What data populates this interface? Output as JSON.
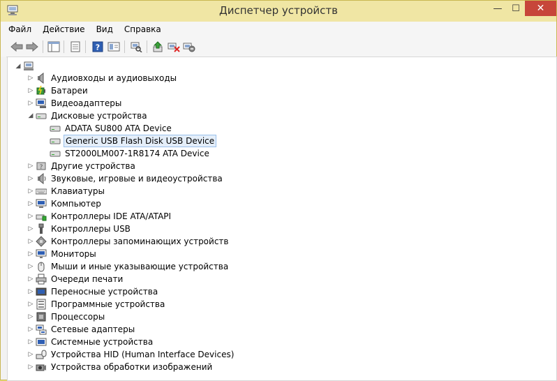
{
  "window": {
    "title": "Диспетчер устройств"
  },
  "menu": {
    "items": [
      "Файл",
      "Действие",
      "Вид",
      "Справка"
    ]
  },
  "toolbar": {
    "buttons": [
      "back-icon",
      "forward-icon",
      "show-hide-tree-icon",
      "properties-icon",
      "help-icon",
      "view-icon",
      "scan-hardware-icon",
      "update-driver-icon",
      "disable-device-icon",
      "uninstall-device-icon"
    ]
  },
  "tree": {
    "root": {
      "label": ""
    },
    "items": [
      {
        "label": "Аудиовходы и аудиовыходы",
        "icon": "speaker-icon"
      },
      {
        "label": "Батареи",
        "icon": "battery-icon"
      },
      {
        "label": "Видеоадаптеры",
        "icon": "display-adapter-icon"
      },
      {
        "label": "Дисковые устройства",
        "icon": "disk-drive-icon",
        "expanded": true,
        "children": [
          {
            "label": "ADATA SU800 ATA Device"
          },
          {
            "label": "Generic USB Flash Disk USB Device",
            "selected": true
          },
          {
            "label": "ST2000LM007-1R8174 ATA Device"
          }
        ]
      },
      {
        "label": "Другие устройства",
        "icon": "other-devices-icon"
      },
      {
        "label": "Звуковые, игровые и видеоустройства",
        "icon": "sound-icon"
      },
      {
        "label": "Клавиатуры",
        "icon": "keyboard-icon"
      },
      {
        "label": "Компьютер",
        "icon": "computer-icon"
      },
      {
        "label": "Контроллеры IDE ATA/ATAPI",
        "icon": "ide-controller-icon"
      },
      {
        "label": "Контроллеры USB",
        "icon": "usb-icon"
      },
      {
        "label": "Контроллеры запоминающих устройств",
        "icon": "storage-controller-icon"
      },
      {
        "label": "Мониторы",
        "icon": "monitor-icon"
      },
      {
        "label": "Мыши и иные указывающие устройства",
        "icon": "mouse-icon"
      },
      {
        "label": "Очереди печати",
        "icon": "printer-icon"
      },
      {
        "label": "Переносные устройства",
        "icon": "portable-device-icon"
      },
      {
        "label": "Программные устройства",
        "icon": "software-device-icon"
      },
      {
        "label": "Процессоры",
        "icon": "processor-icon"
      },
      {
        "label": "Сетевые адаптеры",
        "icon": "network-adapter-icon"
      },
      {
        "label": "Системные устройства",
        "icon": "system-device-icon"
      },
      {
        "label": "Устройства HID (Human Interface Devices)",
        "icon": "hid-icon"
      },
      {
        "label": "Устройства обработки изображений",
        "icon": "imaging-device-icon"
      }
    ]
  }
}
